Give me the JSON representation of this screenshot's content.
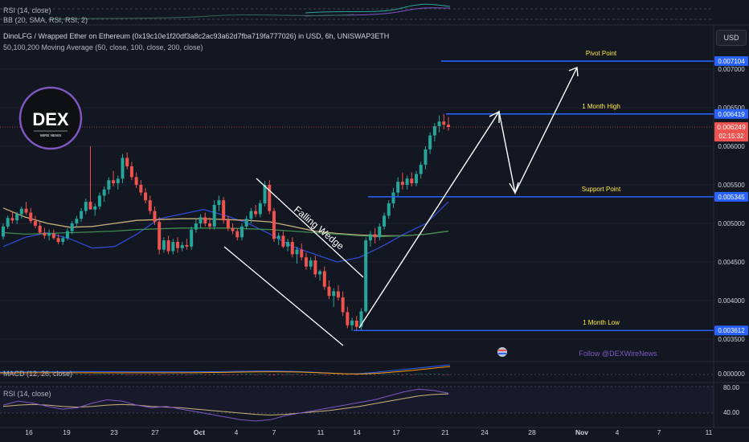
{
  "header": {
    "title": "DinoLFG / Wrapped Ether on Ethereum (0x19c10e1f20df3a8c2ac93a62d7fba719fa777026) in USD, 6h, UNISWAP3ETH",
    "ma_label": "50,100,200 Moving Average (50, close, 100, close, 200, close)",
    "top_label_1": "RSI (14, close)",
    "top_label_2": "BB (20, SMA, RSI, RSI, 2)",
    "currency_button": "USD"
  },
  "logo": {
    "text": "DEX",
    "subtext": "WIRE NEWS"
  },
  "colors": {
    "background": "#131722",
    "up": "#26a69a",
    "down": "#ef5350",
    "level_line": "#2962ff",
    "level_text": "#ffeb3b",
    "ma50": "#2e4bd4",
    "ma100": "#c9b27a",
    "ma200": "#3f8a4e",
    "rsi": "#7e57c2",
    "rsi_ma": "#c9b27a",
    "follow_text": "#7e57c2"
  },
  "chart_data": {
    "type": "candlestick",
    "x_tick_labels": [
      "16",
      "19",
      "23",
      "27",
      "Oct",
      "4",
      "7",
      "11",
      "14",
      "17",
      "21",
      "24",
      "28",
      "Nov",
      "4",
      "7",
      "11"
    ],
    "y_tick_labels": [
      "0.007000",
      "0.006500",
      "0.006000",
      "0.005500",
      "0.005000",
      "0.004500",
      "0.004000",
      "0.003500"
    ],
    "ylim": [
      0.0033,
      0.0077
    ],
    "candles": [
      [
        0.00483,
        0.005,
        0.00479,
        0.00496
      ],
      [
        0.00496,
        0.0051,
        0.00493,
        0.00507
      ],
      [
        0.00507,
        0.00516,
        0.005,
        0.00504
      ],
      [
        0.00504,
        0.00515,
        0.00499,
        0.00512
      ],
      [
        0.00512,
        0.00522,
        0.00506,
        0.00519
      ],
      [
        0.00519,
        0.00528,
        0.00511,
        0.00514
      ],
      [
        0.00514,
        0.0052,
        0.005,
        0.00503
      ],
      [
        0.00503,
        0.0051,
        0.00494,
        0.00497
      ],
      [
        0.00497,
        0.00502,
        0.00486,
        0.00488
      ],
      [
        0.00488,
        0.00494,
        0.0048,
        0.00484
      ],
      [
        0.00484,
        0.00492,
        0.00478,
        0.00487
      ],
      [
        0.00487,
        0.00492,
        0.00479,
        0.00481
      ],
      [
        0.00481,
        0.00486,
        0.00473,
        0.00476
      ],
      [
        0.00476,
        0.00484,
        0.00472,
        0.00481
      ],
      [
        0.00481,
        0.00494,
        0.00478,
        0.0049
      ],
      [
        0.0049,
        0.00503,
        0.00486,
        0.005
      ],
      [
        0.005,
        0.0051,
        0.00495,
        0.00506
      ],
      [
        0.00506,
        0.0052,
        0.00502,
        0.00516
      ],
      [
        0.00516,
        0.00532,
        0.00512,
        0.00528
      ],
      [
        0.00528,
        0.006,
        0.0052,
        0.00518
      ],
      [
        0.00518,
        0.00526,
        0.0051,
        0.00522
      ],
      [
        0.00522,
        0.0054,
        0.00518,
        0.00536
      ],
      [
        0.00536,
        0.00548,
        0.00528,
        0.00544
      ],
      [
        0.00544,
        0.0056,
        0.00538,
        0.00556
      ],
      [
        0.00556,
        0.00568,
        0.00548,
        0.00552
      ],
      [
        0.00552,
        0.00562,
        0.00544,
        0.00558
      ],
      [
        0.00558,
        0.0059,
        0.00552,
        0.00585
      ],
      [
        0.00585,
        0.00592,
        0.0057,
        0.00574
      ],
      [
        0.00574,
        0.0058,
        0.00556,
        0.0056
      ],
      [
        0.0056,
        0.00566,
        0.00546,
        0.0055
      ],
      [
        0.0055,
        0.00556,
        0.00536,
        0.0054
      ],
      [
        0.0054,
        0.00546,
        0.00526,
        0.0053
      ],
      [
        0.0053,
        0.00536,
        0.00512,
        0.00516
      ],
      [
        0.00516,
        0.00522,
        0.00498,
        0.00502
      ],
      [
        0.00502,
        0.00508,
        0.0046,
        0.00466
      ],
      [
        0.00466,
        0.00482,
        0.00462,
        0.00478
      ],
      [
        0.00478,
        0.00484,
        0.0046,
        0.00464
      ],
      [
        0.00464,
        0.0048,
        0.0046,
        0.00476
      ],
      [
        0.00476,
        0.00482,
        0.00462,
        0.00468
      ],
      [
        0.00468,
        0.00476,
        0.00464,
        0.00472
      ],
      [
        0.00472,
        0.0048,
        0.00466,
        0.0047
      ],
      [
        0.0047,
        0.00496,
        0.00466,
        0.00492
      ],
      [
        0.00492,
        0.00506,
        0.00488,
        0.005
      ],
      [
        0.005,
        0.00512,
        0.00494,
        0.00508
      ],
      [
        0.00508,
        0.00514,
        0.00496,
        0.005
      ],
      [
        0.005,
        0.00508,
        0.00492,
        0.00496
      ],
      [
        0.00496,
        0.0053,
        0.00492,
        0.00524
      ],
      [
        0.00524,
        0.00536,
        0.00516,
        0.0053
      ],
      [
        0.0053,
        0.00534,
        0.005,
        0.00504
      ],
      [
        0.00504,
        0.0051,
        0.0049,
        0.00494
      ],
      [
        0.00494,
        0.005,
        0.00486,
        0.0049
      ],
      [
        0.0049,
        0.00494,
        0.00478,
        0.00482
      ],
      [
        0.00482,
        0.005,
        0.00478,
        0.00496
      ],
      [
        0.00496,
        0.0051,
        0.00492,
        0.00506
      ],
      [
        0.00506,
        0.0052,
        0.005,
        0.00516
      ],
      [
        0.00516,
        0.00524,
        0.00508,
        0.00512
      ],
      [
        0.00512,
        0.0053,
        0.00508,
        0.00526
      ],
      [
        0.00526,
        0.00555,
        0.00522,
        0.0055
      ],
      [
        0.0055,
        0.00556,
        0.00512,
        0.00516
      ],
      [
        0.00516,
        0.0052,
        0.00476,
        0.0048
      ],
      [
        0.0048,
        0.00488,
        0.00472,
        0.00484
      ],
      [
        0.00484,
        0.0049,
        0.00468,
        0.0047
      ],
      [
        0.0047,
        0.0048,
        0.00464,
        0.00476
      ],
      [
        0.00476,
        0.00482,
        0.00456,
        0.0046
      ],
      [
        0.0046,
        0.0047,
        0.00448,
        0.00466
      ],
      [
        0.00466,
        0.00474,
        0.00452,
        0.00456
      ],
      [
        0.00456,
        0.00462,
        0.0044,
        0.00444
      ],
      [
        0.00444,
        0.00456,
        0.0044,
        0.00452
      ],
      [
        0.00452,
        0.00458,
        0.0043,
        0.00434
      ],
      [
        0.00434,
        0.0044,
        0.00426,
        0.00438
      ],
      [
        0.00438,
        0.00444,
        0.00414,
        0.00418
      ],
      [
        0.00418,
        0.00426,
        0.00402,
        0.00406
      ],
      [
        0.00406,
        0.00416,
        0.00392,
        0.00412
      ],
      [
        0.00412,
        0.0042,
        0.004,
        0.00404
      ],
      [
        0.00404,
        0.00412,
        0.0038,
        0.00385
      ],
      [
        0.00385,
        0.00392,
        0.00364,
        0.00368
      ],
      [
        0.00368,
        0.00378,
        0.00361,
        0.00374
      ],
      [
        0.00374,
        0.0038,
        0.00362,
        0.00366
      ],
      [
        0.00366,
        0.0039,
        0.00362,
        0.00386
      ],
      [
        0.00386,
        0.00482,
        0.00384,
        0.00478
      ],
      [
        0.00478,
        0.0049,
        0.0047,
        0.00486
      ],
      [
        0.00486,
        0.00494,
        0.00474,
        0.00482
      ],
      [
        0.00482,
        0.005,
        0.00478,
        0.00496
      ],
      [
        0.00496,
        0.00514,
        0.00492,
        0.0051
      ],
      [
        0.0051,
        0.0053,
        0.00506,
        0.00526
      ],
      [
        0.00526,
        0.00546,
        0.0052,
        0.0054
      ],
      [
        0.0054,
        0.0056,
        0.00534,
        0.00554
      ],
      [
        0.00554,
        0.00566,
        0.00544,
        0.0055
      ],
      [
        0.0055,
        0.00562,
        0.00544,
        0.00558
      ],
      [
        0.00558,
        0.00566,
        0.00548,
        0.00552
      ],
      [
        0.00552,
        0.00568,
        0.00548,
        0.00564
      ],
      [
        0.00564,
        0.0058,
        0.00558,
        0.00576
      ],
      [
        0.00576,
        0.006,
        0.0057,
        0.00596
      ],
      [
        0.00596,
        0.00618,
        0.0059,
        0.00614
      ],
      [
        0.00614,
        0.0063,
        0.00606,
        0.00626
      ],
      [
        0.00626,
        0.0064,
        0.00618,
        0.00632
      ],
      [
        0.00632,
        0.00642,
        0.00622,
        0.00628
      ],
      [
        0.00628,
        0.00638,
        0.0062,
        0.00625
      ]
    ],
    "moving_averages": [
      {
        "name": "50",
        "values": [
          0.0047,
          0.00482,
          0.00488,
          0.0048,
          0.00468,
          0.0047,
          0.00486,
          0.00506,
          0.00512,
          0.00518,
          0.0051,
          0.005,
          0.00486,
          0.0047,
          0.0046,
          0.0045,
          0.00456,
          0.0047,
          0.00486,
          0.005,
          0.00528
        ]
      },
      {
        "name": "100",
        "values": [
          0.0052,
          0.00508,
          0.005,
          0.00495,
          0.00496,
          0.005,
          0.00504,
          0.00505,
          0.00506,
          0.00506,
          0.00505,
          0.00504,
          0.00502,
          0.00496,
          0.0049,
          0.00487,
          0.00485,
          0.00484,
          0.00484,
          0.00486,
          0.0049
        ]
      },
      {
        "name": "200",
        "values": [
          0.00488,
          0.00486,
          0.00487,
          0.00488,
          0.00489,
          0.0049,
          0.00492,
          0.00493,
          0.00494,
          0.00494,
          0.00494,
          0.00493,
          0.00492,
          0.0049,
          0.00488,
          0.00486,
          0.00484,
          0.00483,
          0.00484,
          0.00486,
          0.0049
        ]
      }
    ],
    "levels": [
      {
        "label": "Pivot Point",
        "value": 0.007104,
        "price_label": "0.007104"
      },
      {
        "label": "1 Month High",
        "value": 0.006419,
        "price_label": "0.006419"
      },
      {
        "label": "Support Point",
        "value": 0.005345,
        "price_label": "0.005345"
      },
      {
        "label": "1 Month Low",
        "value": 0.003612,
        "price_label": "0.003612"
      }
    ],
    "current_price": {
      "value": 0.006249,
      "label": "0.006249",
      "countdown": "02:15:32"
    },
    "pattern_label": "Falling Wedge",
    "follow_text": "Follow @DEXWireNews",
    "rsi_panel": {
      "label": "RSI (14, close)",
      "ticks": [
        "80.00",
        "40.00"
      ],
      "values": [
        52,
        58,
        55,
        50,
        46,
        48,
        55,
        60,
        58,
        52,
        48,
        50,
        46,
        42,
        38,
        34,
        30,
        28,
        30,
        36,
        40,
        44,
        48,
        52,
        56,
        60,
        66,
        72,
        76,
        74,
        70
      ],
      "ma_values": [
        50,
        52,
        53,
        52,
        50,
        49,
        50,
        52,
        53,
        52,
        50,
        49,
        48,
        46,
        44,
        42,
        40,
        38,
        37,
        38,
        40,
        42,
        44,
        47,
        50,
        54,
        58,
        62,
        66,
        68,
        69
      ]
    },
    "macd_panel": {
      "label": "MACD (12, 26, close)",
      "tick": "0.000000"
    },
    "rsi_top_panel": {
      "label": "RSI (14, close)"
    }
  }
}
